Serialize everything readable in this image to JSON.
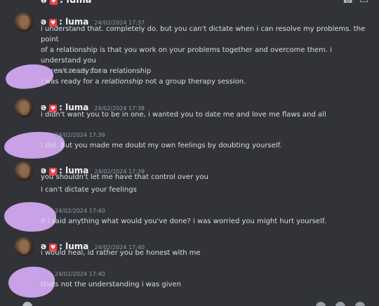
{
  "topbar": {
    "channel_name": ": luma",
    "phone_icon": "phone-icon",
    "video_icon": "video-icon"
  },
  "messages": [
    {
      "type": "luma",
      "prefix": "ə",
      "username": ": luma",
      "timestamp": "24/02/2024 17:37",
      "lines": [
        "i understand that. completely do. but you can't dictate when i can resolve my problems. the point",
        "of a relationship is that you work on your problems together and overcome them. i understand you",
        "weren't ready for a relationship"
      ]
    },
    {
      "type": "other",
      "timestamp": "24/02/2024 17:38",
      "pre": "I was ready for a ",
      "emph": "relationship",
      "post": " not a group therapy session."
    },
    {
      "type": "luma",
      "prefix": "ə",
      "username": ": luma",
      "timestamp": "24/02/2024 17:38",
      "lines": [
        "i didn't want you to be in one, i wanted you to date me and love me flaws and all"
      ]
    },
    {
      "type": "other",
      "timestamp": "24/02/2024 17:39",
      "lines": [
        "I did. But you made me doubt my own feelings by doubting yourself."
      ]
    },
    {
      "type": "luma",
      "prefix": "ə",
      "username": ": luma",
      "timestamp": "24/02/2024 17:39",
      "lines": [
        "you shouldn't let me have that control over you",
        "I can't dictate your feelings"
      ]
    },
    {
      "type": "other",
      "timestamp": "24/02/2024 17:40",
      "lines": [
        "if I said anything what would you've done? i was worried you might hurt yourself."
      ]
    },
    {
      "type": "luma",
      "prefix": "ə",
      "username": ": luma",
      "timestamp": "24/02/2024 17:40",
      "lines": [
        "i would heal, id rather you be honest with me"
      ]
    },
    {
      "type": "other",
      "timestamp": "24/02/2024 17:40",
      "lines": [
        "thats not the understanding i was given"
      ]
    }
  ],
  "colors": {
    "background": "#313338",
    "text": "#dbdee1",
    "muted": "#949ba4",
    "redaction": "#c9a1e6",
    "heart": "#f23f43"
  }
}
